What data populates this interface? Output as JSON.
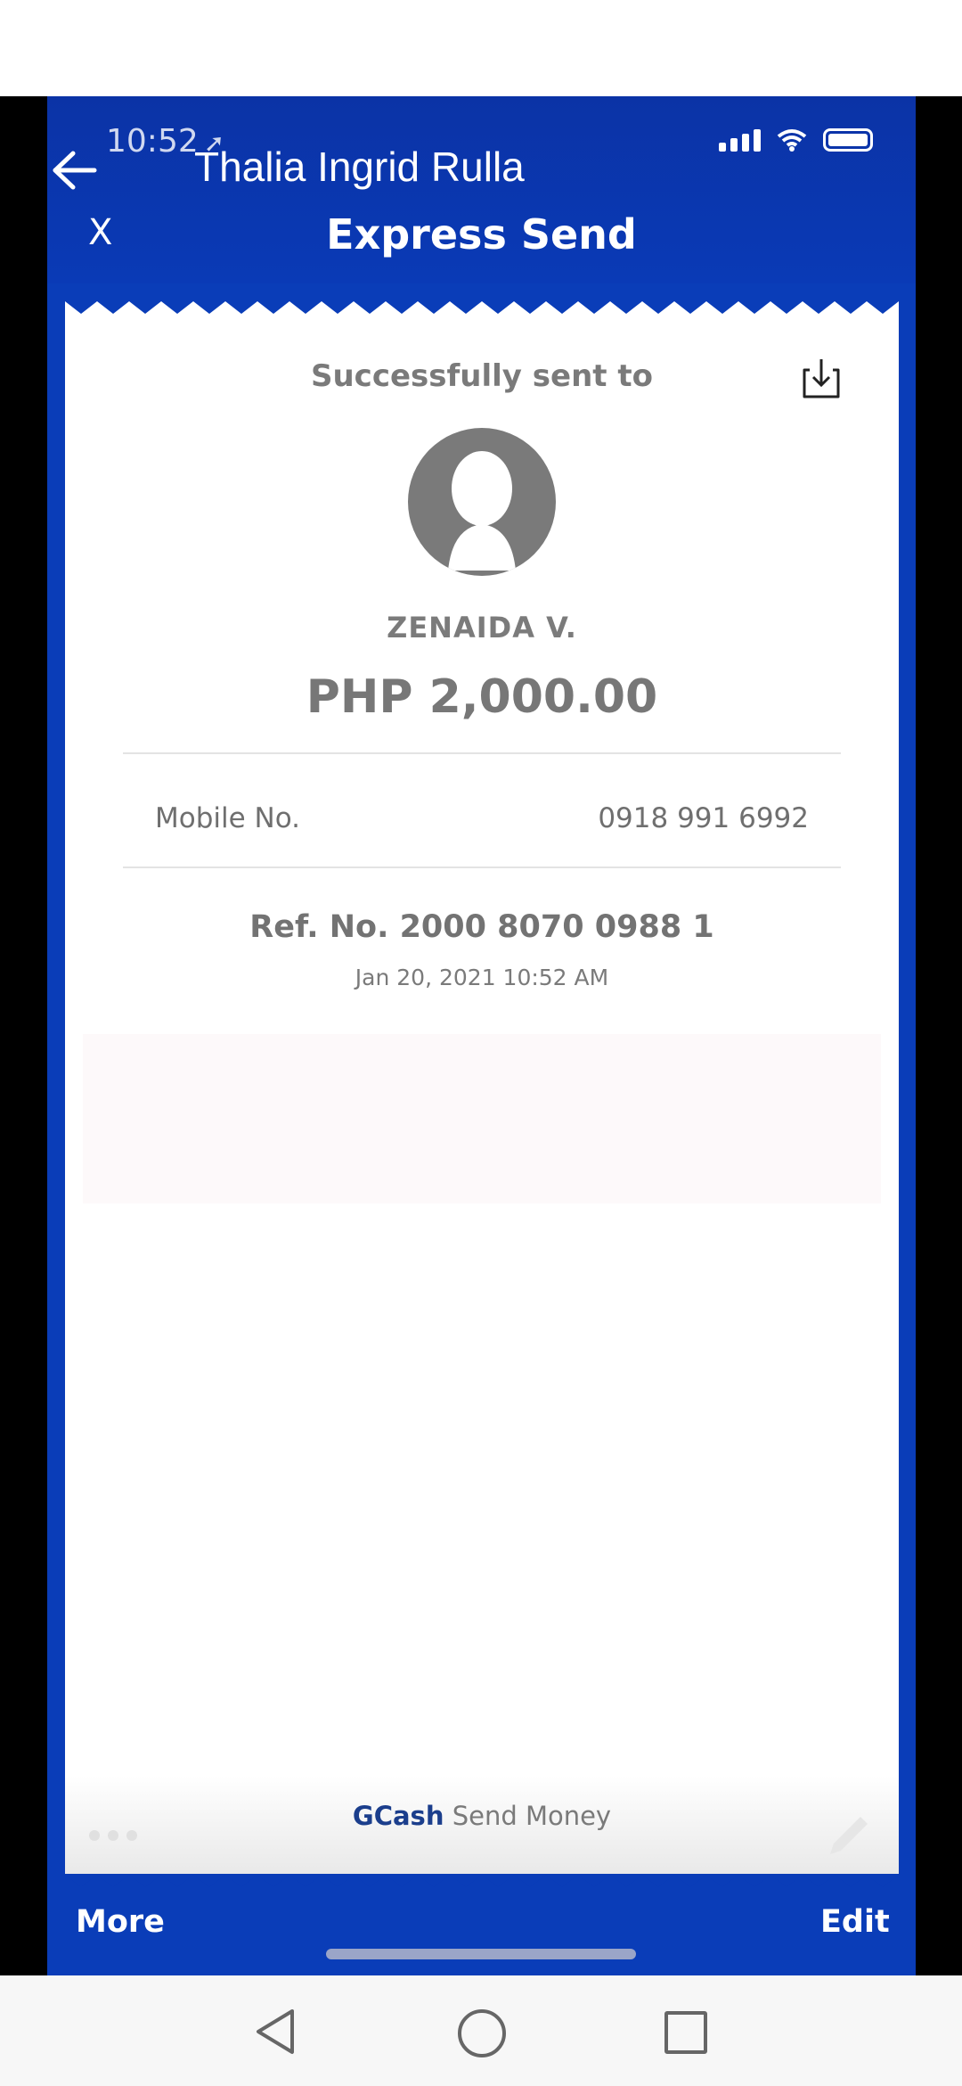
{
  "overlay": {
    "contact_name": "Thalia Ingrid Rulla",
    "back_icon": "arrow-left-icon",
    "more_label": "More",
    "edit_label": "Edit",
    "more_icon": "ellipsis-icon",
    "edit_icon": "pencil-icon"
  },
  "status_bar": {
    "time": "10:52",
    "location_icon": "location-arrow-icon",
    "signal_icon": "signal-icon",
    "wifi_icon": "wifi-icon",
    "battery_icon": "battery-icon"
  },
  "header": {
    "close_label": "X",
    "title": "Express Send"
  },
  "receipt": {
    "heading": "Successfully sent to",
    "download_icon": "download-icon",
    "avatar_icon": "person-silhouette-icon",
    "recipient_name": "ZENAIDA V.",
    "amount": "PHP 2,000.00",
    "mobile_label": "Mobile No.",
    "mobile_value": "0918 991 6992",
    "reference": "Ref. No. 2000 8070 0988 1",
    "timestamp": "Jan 20, 2021 10:52 AM",
    "brand_name": "GCash",
    "brand_suffix": "Send Money"
  },
  "navbar": {
    "back_icon": "triangle-back-icon",
    "home_icon": "circle-home-icon",
    "recent_icon": "square-recents-icon"
  },
  "colors": {
    "brand_blue": "#0a3db8",
    "text_gray": "#777777",
    "gcash_blue": "#1b3e8c"
  }
}
